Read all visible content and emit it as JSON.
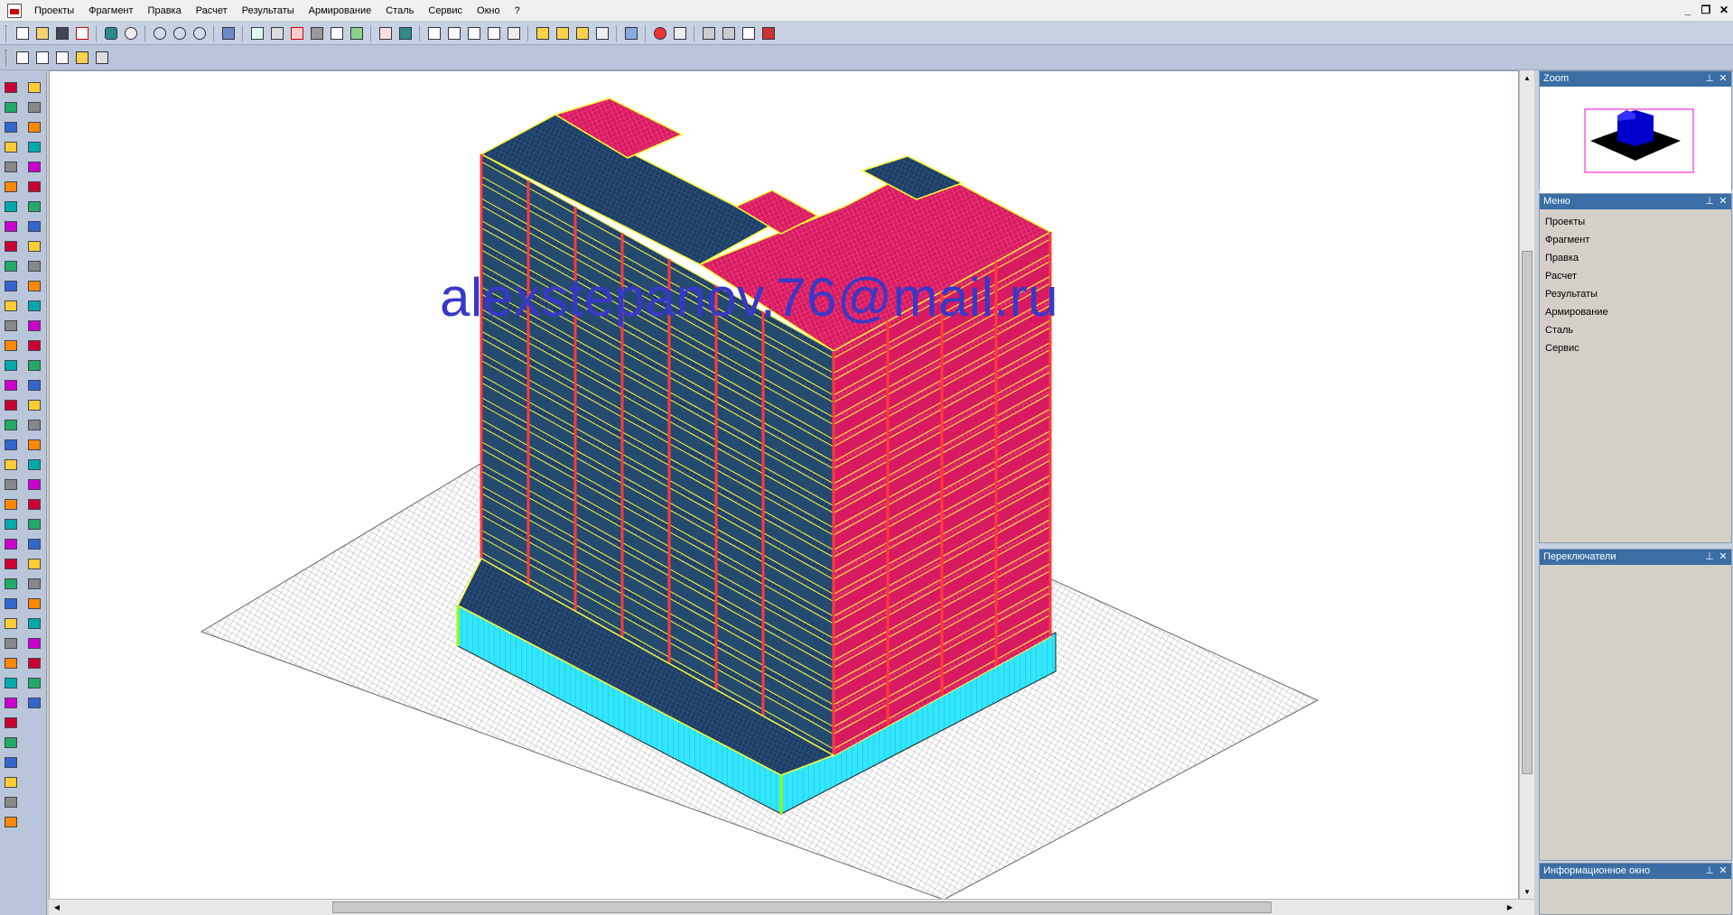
{
  "menubar": {
    "items": [
      "Проекты",
      "Фрагмент",
      "Правка",
      "Расчет",
      "Результаты",
      "Армирование",
      "Сталь",
      "Сервис",
      "Окно",
      "?"
    ],
    "window_controls": [
      "_",
      "❐",
      "✕"
    ]
  },
  "viewport": {
    "watermark": "alexstepanov.76@mail.ru"
  },
  "panels": {
    "zoom": {
      "title": "Zoom"
    },
    "menu": {
      "title": "Меню",
      "items": [
        "Проекты",
        "Фрагмент",
        "Правка",
        "Расчет",
        "Результаты",
        "Армирование",
        "Сталь",
        "Сервис"
      ]
    },
    "switches": {
      "title": "Переключатели"
    },
    "info": {
      "title": "Информационное окно"
    },
    "pin": "⊥",
    "close": "✕"
  },
  "colors": {
    "slab_dark": "#1f3d66",
    "slab_pink": "#d81b60",
    "column_red": "#ff3b3b",
    "beam_yellow": "#ffff33",
    "basement_cyan": "#33e6ff",
    "ground_grid": "#9a9a9a",
    "watermark": "#3838c8"
  }
}
